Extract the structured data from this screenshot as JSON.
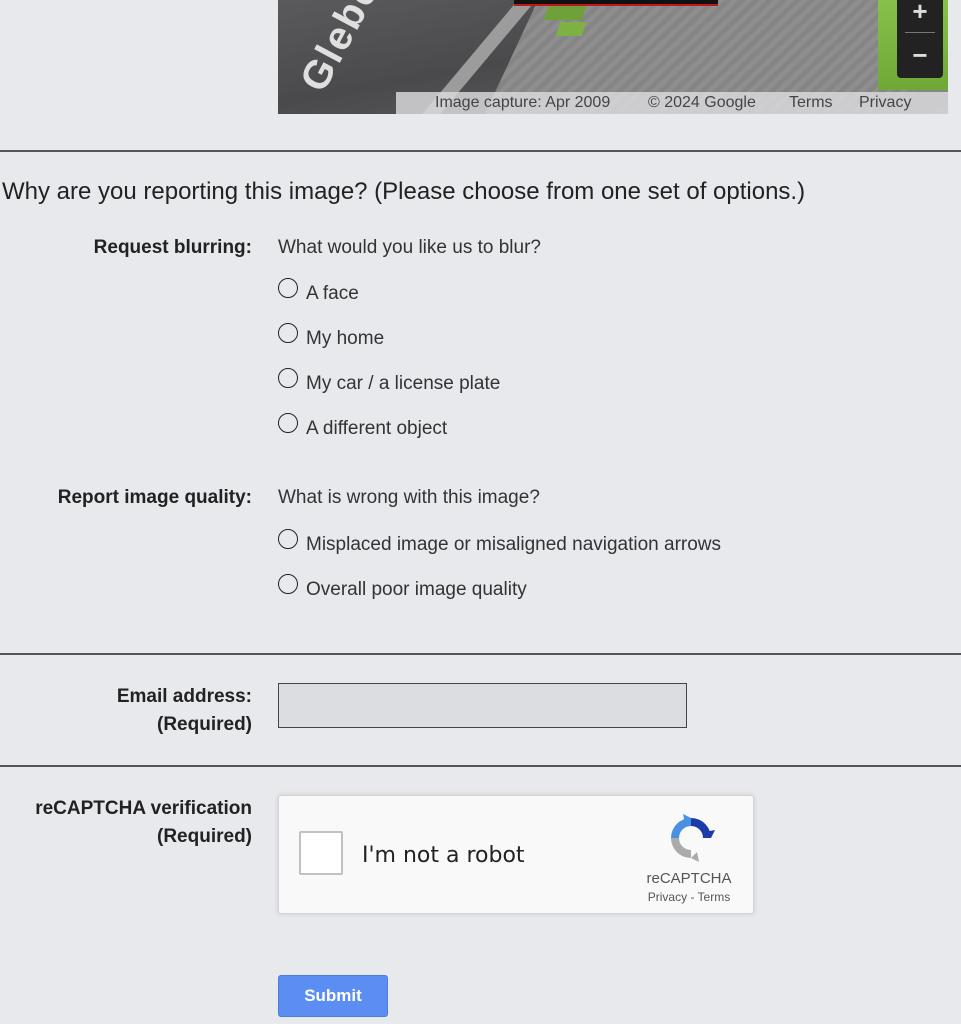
{
  "image": {
    "street_name": "Glebe",
    "attribution": {
      "capture": "Image capture: Apr 2009",
      "copyright": "© 2024 Google",
      "terms": "Terms",
      "privacy": "Privacy"
    },
    "zoom": {
      "in": "+",
      "out": "−"
    }
  },
  "question": "Why are you reporting this image?  (Please choose from one set of options.)",
  "blurring": {
    "label": "Request blurring:",
    "prompt": "What would you like us to blur?",
    "options": [
      "A face",
      "My home",
      "My car / a license plate",
      "A different object"
    ]
  },
  "quality": {
    "label": "Report image quality:",
    "prompt": "What is wrong with this image?",
    "options": [
      "Misplaced image or misaligned navigation arrows",
      "Overall poor image quality"
    ]
  },
  "email": {
    "label": "Email address:",
    "required": "(Required)",
    "value": ""
  },
  "recaptcha": {
    "label": "reCAPTCHA verification",
    "required": "(Required)",
    "checkbox_label": "I'm not a robot",
    "brand": "reCAPTCHA",
    "links": "Privacy - Terms"
  },
  "submit_label": "Submit",
  "colors": {
    "background": "#e8e9ed",
    "submit": "#5b8df2",
    "recaptcha_blue": "#4a90e2",
    "recaptcha_dark_blue": "#1c3aa9",
    "recaptcha_gray": "#ababab"
  }
}
